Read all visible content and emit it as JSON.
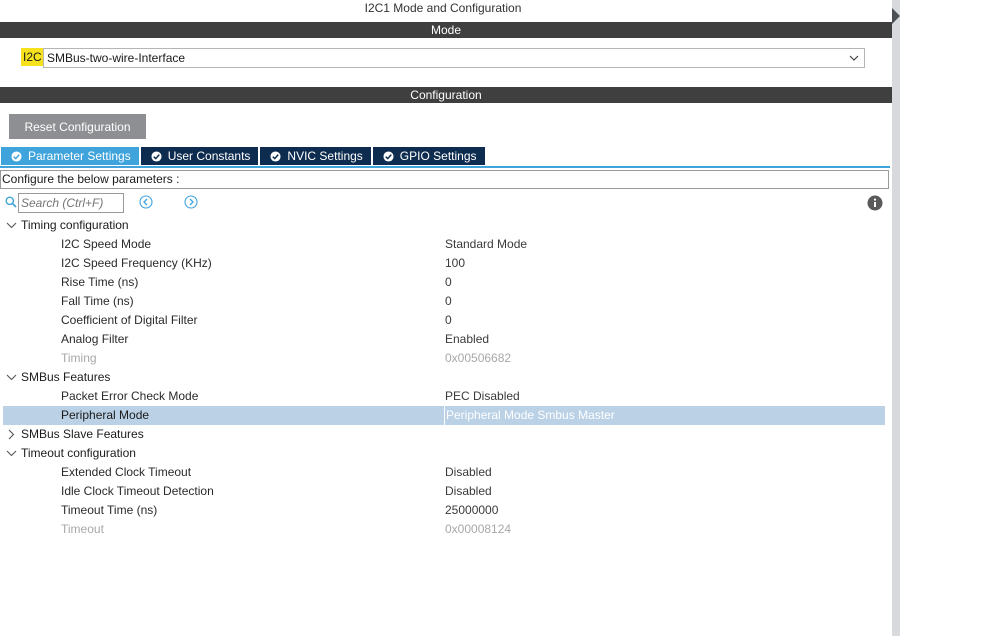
{
  "window": {
    "title": "I2C1 Mode and Configuration"
  },
  "mode_section": {
    "header": "Mode",
    "label": "I2C",
    "selected_mode": "SMBus-two-wire-Interface"
  },
  "config_section": {
    "header": "Configuration",
    "reset_button": "Reset Configuration",
    "tabs": [
      {
        "label": "Parameter Settings",
        "active": true
      },
      {
        "label": "User Constants",
        "active": false
      },
      {
        "label": "NVIC Settings",
        "active": false
      },
      {
        "label": "GPIO Settings",
        "active": false
      }
    ],
    "hint": "Configure the below parameters :",
    "search": {
      "placeholder": "Search (Ctrl+F)"
    }
  },
  "groups": [
    {
      "label": "Timing configuration",
      "expanded": true,
      "params": [
        {
          "label": "I2C Speed Mode",
          "value": "Standard Mode"
        },
        {
          "label": "I2C Speed Frequency (KHz)",
          "value": "100"
        },
        {
          "label": "Rise Time (ns)",
          "value": "0"
        },
        {
          "label": "Fall Time (ns)",
          "value": "0"
        },
        {
          "label": "Coefficient of Digital Filter",
          "value": "0"
        },
        {
          "label": "Analog Filter",
          "value": "Enabled"
        },
        {
          "label": "Timing",
          "value": "0x00506682"
        }
      ]
    },
    {
      "label": "SMBus Features",
      "expanded": true,
      "params": [
        {
          "label": "Packet Error Check Mode",
          "value": "PEC Disabled"
        },
        {
          "label": "Peripheral Mode",
          "value": "Peripheral Mode Smbus Master"
        }
      ]
    },
    {
      "label": "SMBus Slave Features",
      "expanded": false,
      "params": []
    },
    {
      "label": "Timeout configuration",
      "expanded": true,
      "params": [
        {
          "label": "Extended Clock Timeout",
          "value": "Disabled"
        },
        {
          "label": "Idle Clock Timeout Detection",
          "value": "Disabled"
        },
        {
          "label": "Timeout Time (ns)",
          "value": "25000000"
        },
        {
          "label": "Timeout",
          "value": "0x00008124"
        }
      ]
    }
  ],
  "colors": {
    "section_bar": "#3f3f3f",
    "tab_active": "#3fa3dc",
    "tab_inactive": "#0e2c4f",
    "mode_label_highlight": "#f5e11d",
    "selected_row": "#bad1e6",
    "disabled_text": "#a8a8a8"
  }
}
